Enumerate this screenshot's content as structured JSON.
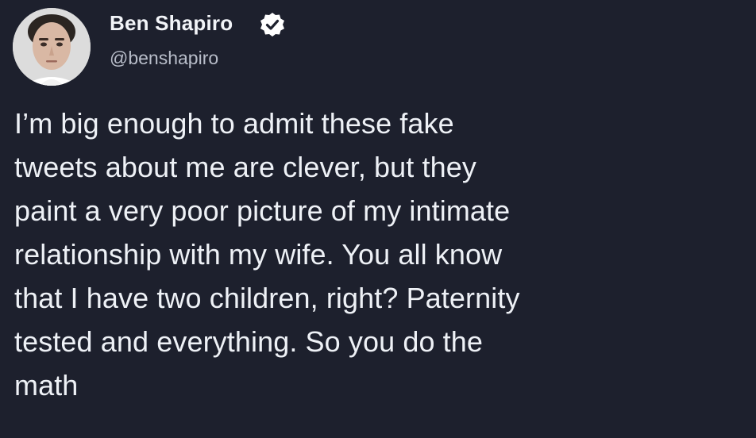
{
  "author": {
    "display_name": "Ben Shapiro",
    "handle": "@benshapiro",
    "verified": true,
    "avatar_icon": "profile-photo"
  },
  "tweet": {
    "lines": [
      "I’m big enough to admit these fake",
      "tweets about me are clever, but they",
      "paint a very poor picture of my intimate",
      "relationship with my wife. You all know",
      "that I have two children, right? Paternity",
      "tested and everything. So you do the",
      "math"
    ]
  },
  "colors": {
    "background": "#1d202d",
    "text": "#eef1f6",
    "handle": "#b8bdc9",
    "verified_badge": "#ffffff"
  }
}
